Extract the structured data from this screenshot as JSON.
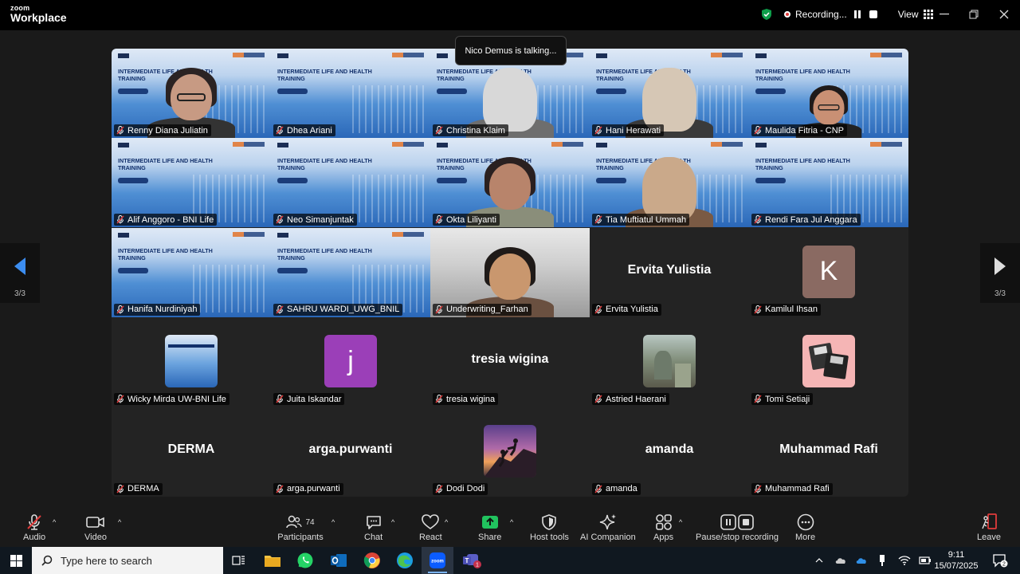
{
  "brand": {
    "line1": "zoom",
    "line2": "Workplace"
  },
  "recording": {
    "label": "Recording...",
    "view_label": "View"
  },
  "speaker_notice": "Nico Demus is talking...",
  "slide_text": "INTERMEDIATE LIFE AND HEALTH TRAINING",
  "slide_subtext": "FOR BNI LIFE",
  "page_indicator": {
    "left": "3/3",
    "right": "3/3"
  },
  "participants": [
    {
      "name": "Renny Diana Juliatin",
      "kind": "video"
    },
    {
      "name": "Dhea Ariani",
      "kind": "slide"
    },
    {
      "name": "Christina Klaim",
      "kind": "video"
    },
    {
      "name": "Hani Herawati",
      "kind": "video"
    },
    {
      "name": "Maulida Fitria - CNP",
      "kind": "video"
    },
    {
      "name": "Alif Anggoro - BNI Life",
      "kind": "slide"
    },
    {
      "name": "Neo Simanjuntak",
      "kind": "slide"
    },
    {
      "name": "Okta Liliyanti",
      "kind": "video"
    },
    {
      "name": "Tia Muftiatul Ummah",
      "kind": "video"
    },
    {
      "name": "Rendi Fara Jul Anggara",
      "kind": "slide"
    },
    {
      "name": "Hanifa Nurdiniyah",
      "kind": "slide"
    },
    {
      "name": "SAHRU WARDI_UWG_BNIL",
      "kind": "slide"
    },
    {
      "name": "Underwriting_Farhan",
      "kind": "video"
    },
    {
      "name": "Ervita Yulistia",
      "kind": "name",
      "display": "Ervita Yulistia"
    },
    {
      "name": "Kamilul Ihsan",
      "kind": "avatar",
      "letter": "K",
      "color": "#8a6a62"
    },
    {
      "name": "Wicky Mirda UW-BNI Life",
      "kind": "avatar-slide"
    },
    {
      "name": "Juita Iskandar",
      "kind": "avatar",
      "letter": "j",
      "color": "#9b3fb8"
    },
    {
      "name": "tresia wigina",
      "kind": "name",
      "display": "tresia wigina"
    },
    {
      "name": "Astried Haerani",
      "kind": "avatar-photo"
    },
    {
      "name": "Tomi Setiaji",
      "kind": "avatar-floppy"
    },
    {
      "name": "DERMA",
      "kind": "name",
      "display": "DERMA"
    },
    {
      "name": "arga.purwanti",
      "kind": "name",
      "display": "arga.purwanti"
    },
    {
      "name": "Dodi Dodi",
      "kind": "avatar-climb"
    },
    {
      "name": "amanda",
      "kind": "name",
      "display": "amanda"
    },
    {
      "name": "Muhammad Rafi",
      "kind": "name",
      "display": "Muhammad Rafi"
    }
  ],
  "toolbar": {
    "audio": "Audio",
    "video": "Video",
    "participants": "Participants",
    "participants_count": "74",
    "chat": "Chat",
    "react": "React",
    "share": "Share",
    "host_tools": "Host tools",
    "ai_companion": "AI Companion",
    "apps": "Apps",
    "pause_stop": "Pause/stop recording",
    "more": "More",
    "leave": "Leave"
  },
  "taskbar": {
    "search_placeholder": "Type here to search",
    "time": "9:11",
    "date": "15/07/2025",
    "notifications": "2",
    "teams_badge": "1"
  },
  "colors": {
    "accent_green": "#0e9e4a",
    "share_green": "#21c25e",
    "recording_red": "#e03b3b"
  }
}
